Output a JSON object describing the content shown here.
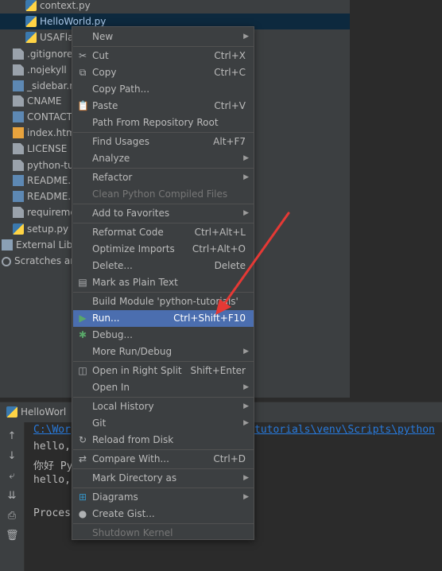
{
  "project_tree": {
    "items": [
      {
        "name": "context.py",
        "type": "py"
      },
      {
        "name": "HelloWorld.py",
        "type": "py"
      },
      {
        "name": "USAFlag",
        "type": "py"
      },
      {
        "name": ".gitignore",
        "type": "txt"
      },
      {
        "name": ".nojekyll",
        "type": "txt"
      },
      {
        "name": "_sidebar.m",
        "type": "md"
      },
      {
        "name": "CNAME",
        "type": "txt"
      },
      {
        "name": "CONTACT.",
        "type": "md"
      },
      {
        "name": "index.html",
        "type": "html"
      },
      {
        "name": "LICENSE",
        "type": "txt"
      },
      {
        "name": "python-tut",
        "type": "txt"
      },
      {
        "name": "README.m",
        "type": "md"
      },
      {
        "name": "README.rs",
        "type": "md"
      },
      {
        "name": "requiremen",
        "type": "txt"
      },
      {
        "name": "setup.py",
        "type": "py"
      },
      {
        "name": "External Librar",
        "type": "ext"
      },
      {
        "name": "Scratches and",
        "type": "scr"
      }
    ]
  },
  "run_window": {
    "tab_label": "HelloWorl",
    "console_lines": [
      {
        "text": "C:\\Wor",
        "link": true
      },
      {
        "text": "hello,",
        "link": false
      },
      {
        "text": "你好 Py",
        "link": false
      },
      {
        "text": "hello,",
        "link": false
      },
      {
        "text": "",
        "link": false
      },
      {
        "text": "Proces",
        "link": false
      }
    ],
    "console_right_link": "tutorials\\venv\\Scripts\\python"
  },
  "context_menu": {
    "items": [
      {
        "label": "New",
        "shortcut": "",
        "submenu": true,
        "icon": ""
      },
      {
        "sep": true
      },
      {
        "label": "Cut",
        "shortcut": "Ctrl+X",
        "icon": "✂",
        "icon_name": "cut-icon"
      },
      {
        "label": "Copy",
        "shortcut": "Ctrl+C",
        "icon": "⧉",
        "icon_name": "copy-icon"
      },
      {
        "label": "Copy Path...",
        "shortcut": ""
      },
      {
        "label": "Paste",
        "shortcut": "Ctrl+V",
        "icon": "📋",
        "icon_name": "paste-icon"
      },
      {
        "label": "Path From Repository Root",
        "shortcut": ""
      },
      {
        "sep": true
      },
      {
        "label": "Find Usages",
        "shortcut": "Alt+F7"
      },
      {
        "label": "Analyze",
        "submenu": true
      },
      {
        "sep": true
      },
      {
        "label": "Refactor",
        "submenu": true
      },
      {
        "label": "Clean Python Compiled Files",
        "disabled": true
      },
      {
        "sep": true
      },
      {
        "label": "Add to Favorites",
        "submenu": true
      },
      {
        "sep": true
      },
      {
        "label": "Reformat Code",
        "shortcut": "Ctrl+Alt+L"
      },
      {
        "label": "Optimize Imports",
        "shortcut": "Ctrl+Alt+O"
      },
      {
        "label": "Delete...",
        "shortcut": "Delete"
      },
      {
        "label": "Mark as Plain Text",
        "icon": "▤",
        "icon_name": "plain-text-icon"
      },
      {
        "sep": true
      },
      {
        "label": "Build Module 'python-tutorials'"
      },
      {
        "label": "Run...",
        "shortcut": "Ctrl+Shift+F10",
        "icon": "▶",
        "icon_name": "run-icon",
        "highlight": true
      },
      {
        "label": "Debug...",
        "icon": "✱",
        "icon_name": "debug-icon"
      },
      {
        "label": "More Run/Debug",
        "submenu": true
      },
      {
        "sep": true
      },
      {
        "label": "Open in Right Split",
        "shortcut": "Shift+Enter",
        "icon": "◫",
        "icon_name": "split-icon"
      },
      {
        "label": "Open In",
        "submenu": true
      },
      {
        "sep": true
      },
      {
        "label": "Local History",
        "submenu": true
      },
      {
        "label": "Git",
        "submenu": true
      },
      {
        "label": "Reload from Disk",
        "icon": "↻",
        "icon_name": "reload-icon"
      },
      {
        "sep": true
      },
      {
        "label": "Compare With...",
        "shortcut": "Ctrl+D",
        "icon": "⇄",
        "icon_name": "compare-icon"
      },
      {
        "sep": true
      },
      {
        "label": "Mark Directory as",
        "submenu": true
      },
      {
        "sep": true
      },
      {
        "label": "Diagrams",
        "submenu": true,
        "icon": "⊞",
        "icon_name": "diagrams-icon"
      },
      {
        "label": "Create Gist...",
        "icon": "●",
        "icon_name": "github-icon"
      },
      {
        "sep": true
      },
      {
        "label": "Shutdown Kernel",
        "disabled": true
      }
    ]
  },
  "colors": {
    "highlight": "#4b6eaf",
    "annotation_arrow": "#e53935"
  }
}
